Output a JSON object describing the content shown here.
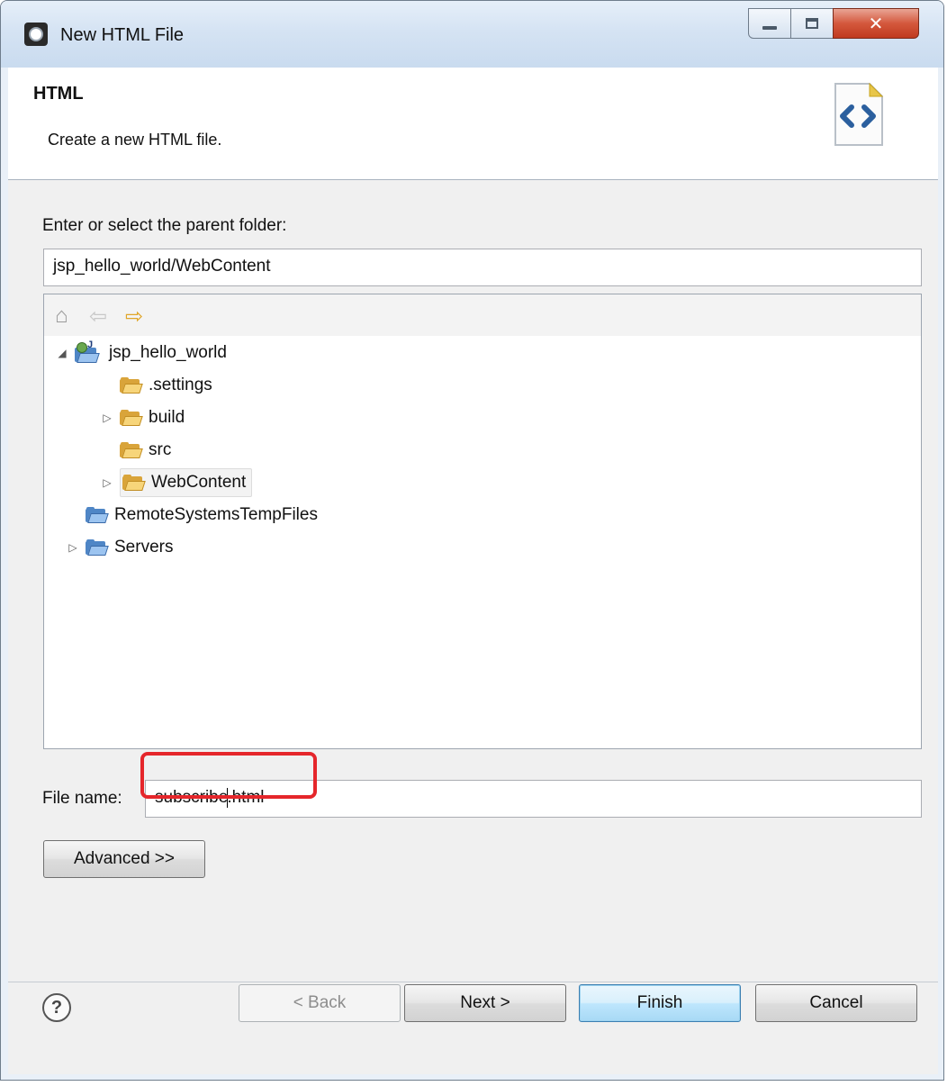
{
  "window": {
    "title": "New HTML File"
  },
  "banner": {
    "title": "HTML",
    "description": "Create a new HTML file."
  },
  "parent_folder": {
    "label": "Enter or select the parent folder:",
    "value": "jsp_hello_world/WebContent"
  },
  "tree": {
    "toolbar": [
      "home-icon",
      "back-arrow-icon",
      "forward-arrow-icon"
    ],
    "project": "jsp_hello_world",
    "children": [
      ".settings",
      "build",
      "src",
      "WebContent"
    ],
    "other_projects": [
      "RemoteSystemsTempFiles",
      "Servers"
    ]
  },
  "file_name": {
    "label": "File name:",
    "value_before_caret": "subscribe",
    "value_after_caret": ".html"
  },
  "buttons": {
    "advanced": "Advanced >>",
    "back": "< Back",
    "next": "Next >",
    "finish": "Finish",
    "cancel": "Cancel"
  },
  "colors": {
    "highlight": "#e5262b",
    "default_button": "#a7d9f5",
    "close_button": "#c03a1f"
  }
}
